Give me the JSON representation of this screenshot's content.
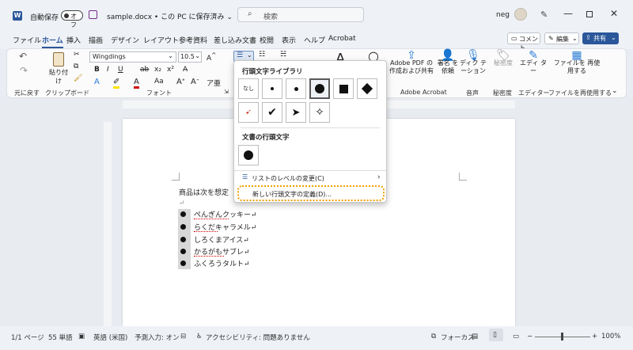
{
  "titlebar": {
    "autosave_label": "自動保存",
    "autosave_state": "オフ",
    "doc_title": "sample.docx • この PC に保存済み ⌄",
    "search_placeholder": "検索",
    "user_name": "neg"
  },
  "tabs": [
    "ファイル",
    "ホーム",
    "挿入",
    "描画",
    "デザイン",
    "レイアウト",
    "参考資料",
    "差し込み文書",
    "校閲",
    "表示",
    "ヘルプ",
    "Acrobat"
  ],
  "tab_actions": {
    "comment": "コメント",
    "edit": "編集",
    "share": "共有"
  },
  "ribbon": {
    "undo_label": "元に戻す",
    "paste_label": "貼り付け",
    "clipboard_label": "クリップボード",
    "font_name": "Wingdings",
    "font_size": "10.5",
    "font_group_label": "フォント",
    "adobe_pdf": "Adobe PDF の 作成および共有",
    "sign_request": "署名 を依頼",
    "adobe_group": "Adobe Acrobat",
    "dictation": "ディク テーション",
    "voice_group": "音声",
    "sensitivity": "秘密度",
    "sensitivity_group": "秘密度",
    "editor": "エディ ター",
    "editor_group": "エディター",
    "reuse": "ファイルを 再使用する",
    "reuse_group": "ファイルを再使用する"
  },
  "menu": {
    "library_heading": "行頭文字ライブラリ",
    "none_label": "なし",
    "document_heading": "文書の行頭文字",
    "change_level": "リストのレベルの変更(C)",
    "define_new": "新しい行頭文字の定義(D)..."
  },
  "document": {
    "intro_line": "商品は次を想定",
    "return_mark": "↵",
    "items": [
      "ぺんぎんクッキー↵",
      "らくだキャラメル↵",
      "しろくまアイス↵",
      "かるがもサブレ↵",
      "ふくろうタルト↵"
    ]
  },
  "status": {
    "page": "1/1 ページ",
    "words": "55 単語",
    "language": "英語 (米国)",
    "predict": "予測入力: オン",
    "accessibility": "アクセシビリティ: 問題ありません",
    "focus": "フォーカス",
    "zoom": "100%"
  },
  "colors": {
    "accent": "#2b579a",
    "highlight": "#f3a000"
  }
}
